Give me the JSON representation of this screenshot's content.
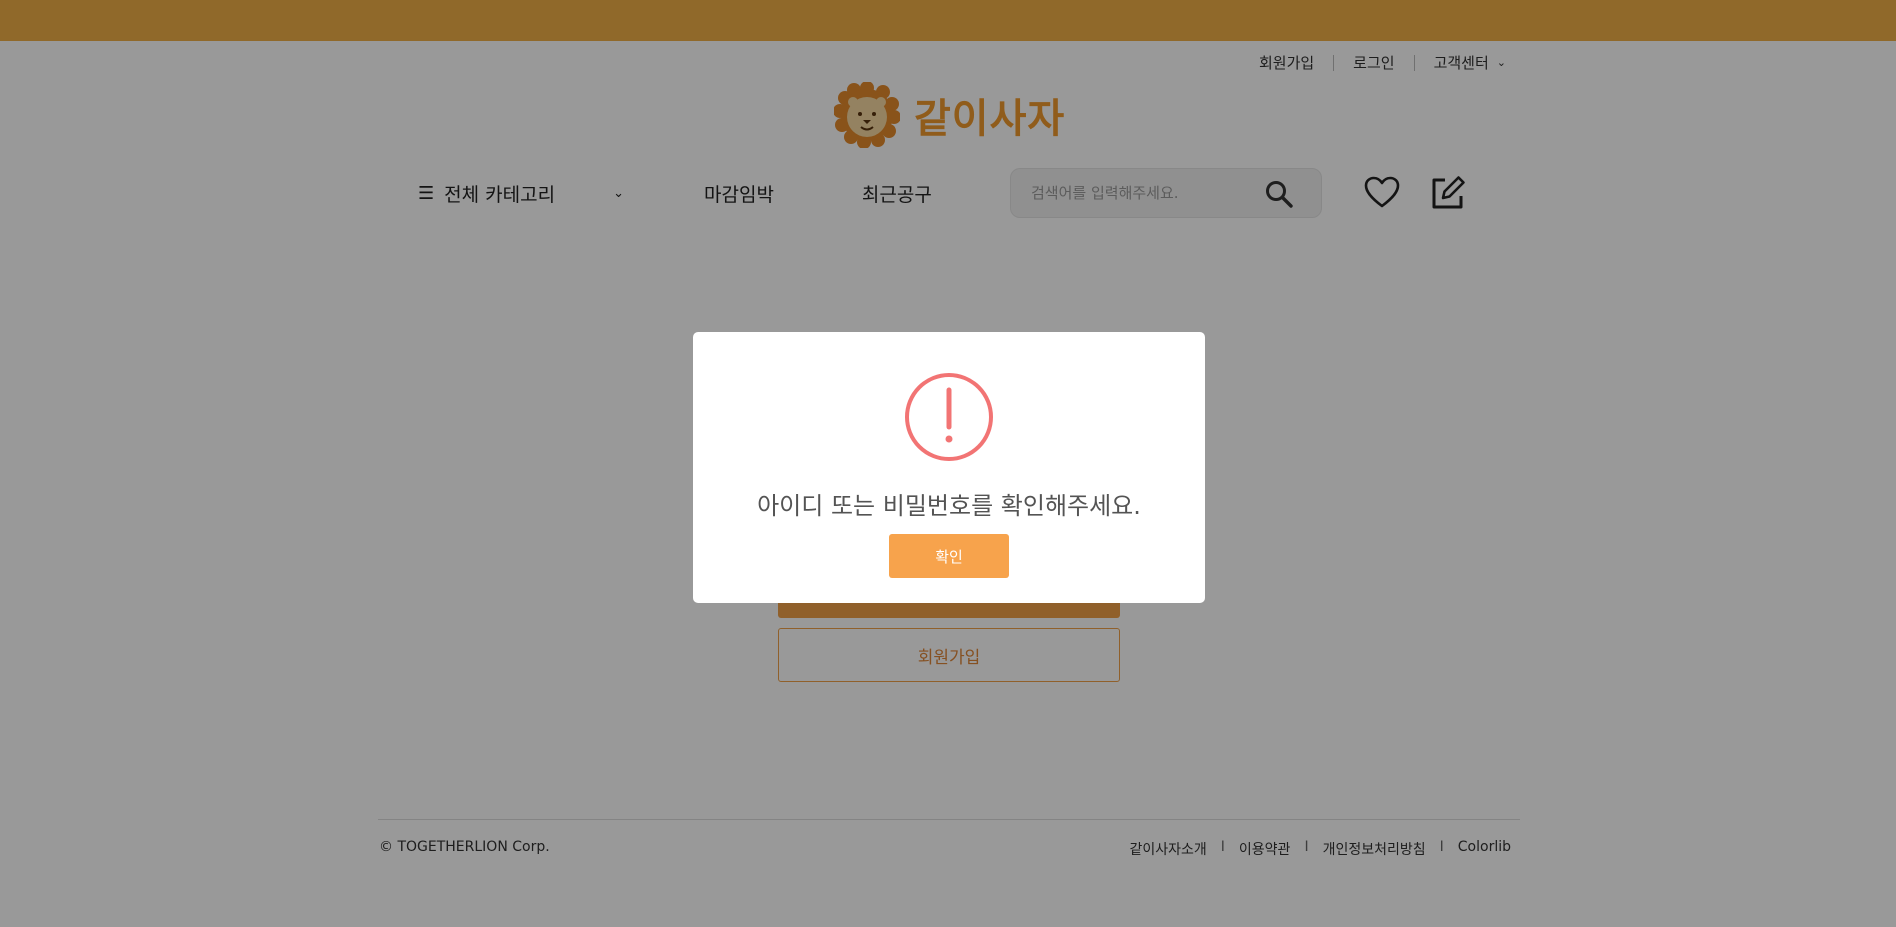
{
  "util_nav": {
    "signup": "회원가입",
    "login": "로그인",
    "support": "고객센터"
  },
  "logo": {
    "text": "같이사자"
  },
  "nav": {
    "category": "전체 카테고리",
    "deadline": "마감임박",
    "recent": "최근공구"
  },
  "search": {
    "placeholder": "검색어를 입력해주세요."
  },
  "form": {
    "signup_label": "회원가입"
  },
  "footer": {
    "copyright": "© TOGETHERLION Corp.",
    "links": [
      "같이사자소개",
      "이용약관",
      "개인정보처리방침",
      "Colorlib"
    ],
    "separator": "I"
  },
  "modal": {
    "message": "아이디 또는 비밀번호를 확인해주세요.",
    "confirm": "확인"
  },
  "colors": {
    "brand": "#f0a149",
    "topbar": "#f0b046",
    "warning": "#f27474"
  }
}
